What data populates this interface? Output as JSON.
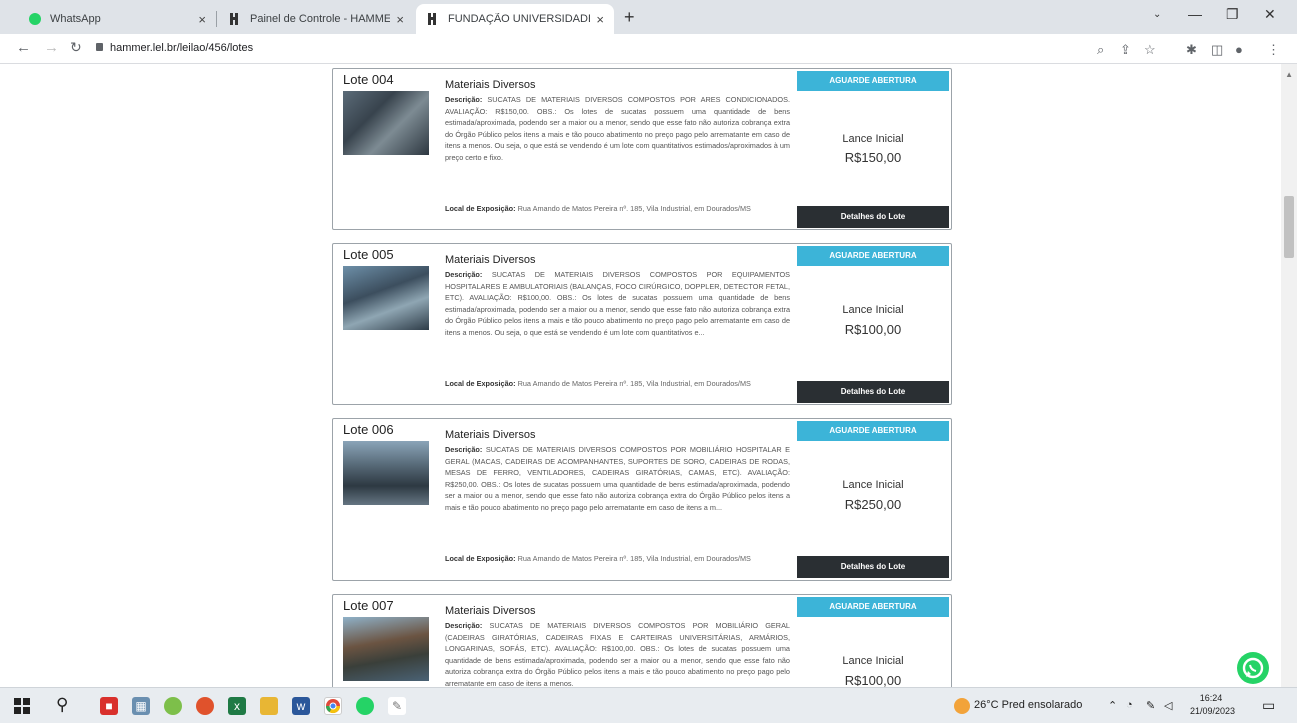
{
  "tabs": [
    {
      "title": "WhatsApp",
      "close": "×"
    },
    {
      "title": "Painel de Controle - HAMMER | C",
      "close": "×"
    },
    {
      "title": "FUNDAÇÃO UNIVERSIDADE FEDE",
      "close": "×"
    }
  ],
  "new_tab_label": "+",
  "address": {
    "url": "hammer.lel.br/leilao/456/lotes"
  },
  "status_label": "AGUARDE ABERTURA",
  "lance_label": "Lance Inicial",
  "details_label": "Detalhes do Lote",
  "item_name": "Materiais Diversos",
  "desc_prefix": "Descrição:",
  "local_prefix": "Local de Exposição:",
  "local_text": "Rua Amando de Matos Pereira nº. 185, Vila Industrial, em Dourados/MS",
  "lots": [
    {
      "title": "Lote 004",
      "description": "SUCATAS DE MATERIAIS DIVERSOS COMPOSTOS POR ARES CONDICIONADOS. AVALIAÇÃO: R$150,00. OBS.: Os lotes de sucatas possuem uma quantidade de bens estimada/aproximada, podendo ser a maior ou a menor, sendo que esse fato não autoriza cobrança extra do Órgão Público pelos itens a mais e tão pouco abatimento no preço pago pelo arrematante em caso de itens a menos. Ou seja, o que está se vendendo é um lote com quantitativos estimados/aproximados à um preço certo e fixo.",
      "price": "R$150,00"
    },
    {
      "title": "Lote 005",
      "description": "SUCATAS DE MATERIAIS DIVERSOS COMPOSTOS POR EQUIPAMENTOS HOSPITALARES E AMBULATORIAIS (BALANÇAS, FOCO CIRÚRGICO, DOPPLER, DETECTOR FETAL, ETC). AVALIAÇÃO: R$100,00. OBS.: Os lotes de sucatas possuem uma quantidade de bens estimada/aproximada, podendo ser a maior ou a menor, sendo que esse fato não autoriza cobrança extra do Órgão Público pelos itens a mais e tão pouco abatimento no preço pago pelo arrematante em caso de itens a menos. Ou seja, o que está se vendendo é um lote com quantitativos e...",
      "price": "R$100,00"
    },
    {
      "title": "Lote 006",
      "description": "SUCATAS DE MATERIAIS DIVERSOS COMPOSTOS POR MOBILIÁRIO HOSPITALAR E GERAL (MACAS, CADEIRAS DE ACOMPANHANTES, SUPORTES DE SORO, CADEIRAS DE RODAS, MESAS DE FERRO, VENTILADORES, CADEIRAS GIRATÓRIAS, CAMAS, ETC). AVALIAÇÃO: R$250,00. OBS.: Os lotes de sucatas possuem uma quantidade de bens estimada/aproximada, podendo ser a maior ou a menor, sendo que esse fato não autoriza cobrança extra do Órgão Público pelos itens a mais e tão pouco abatimento no preço pago pelo arrematante em caso de itens a m...",
      "price": "R$250,00"
    },
    {
      "title": "Lote 007",
      "description": "SUCATAS DE MATERIAIS DIVERSOS COMPOSTOS POR MOBILIÁRIO GERAL (CADEIRAS GIRATÓRIAS, CADEIRAS FIXAS E CARTEIRAS UNIVERSITÁRIAS, ARMÁRIOS, LONGARINAS, SOFÁS, ETC). AVALIAÇÃO: R$100,00. OBS.: Os lotes de sucatas possuem uma quantidade de bens estimada/aproximada, podendo ser a maior ou a menor, sendo que esse fato não autoriza cobrança extra do Órgão Público pelos itens a mais e tão pouco abatimento no preço pago pelo arrematante em caso de itens a menos.",
      "price": "R$100,00"
    }
  ],
  "taskbar": {
    "weather": "26°C Pred ensolarado",
    "time": "16:24",
    "date": "21/09/2023"
  },
  "colors": {
    "badge": "#3cb4d8",
    "details_button": "#2a2f33",
    "whatsapp": "#25d366"
  }
}
